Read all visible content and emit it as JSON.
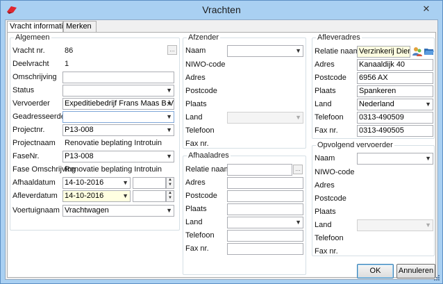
{
  "window": {
    "title": "Vrachten",
    "close_glyph": "✕"
  },
  "tabs": [
    {
      "label": "Vracht informatie"
    },
    {
      "label": "Merken"
    }
  ],
  "algemeen": {
    "title": "Algemeen",
    "vracht_nr": {
      "label": "Vracht nr.",
      "value": "86"
    },
    "deelvracht": {
      "label": "Deelvracht",
      "value": "1"
    },
    "omschrijving": {
      "label": "Omschrijving",
      "value": ""
    },
    "status": {
      "label": "Status",
      "value": ""
    },
    "vervoerder": {
      "label": "Vervoerder",
      "value": "Expeditiebedrijf Frans Maas B.V."
    },
    "geadresseerde": {
      "label": "Geadresseerde",
      "value": ""
    },
    "projectnr": {
      "label": "Projectnr.",
      "value": "P13-008"
    },
    "projectnaam": {
      "label": "Projectnaam",
      "value": "Renovatie beplating Introtuin"
    },
    "fasenr": {
      "label": "FaseNr.",
      "value": "P13-008"
    },
    "fase_omschrijving": {
      "label": "Fase Omschrijving",
      "value": "Renovatie beplating Introtuin"
    },
    "afhaaldatum": {
      "label": "Afhaaldatum",
      "value": "14-10-2016",
      "time": ""
    },
    "afleverdatum": {
      "label": "Afleverdatum",
      "value": "14-10-2016",
      "time": ""
    },
    "voertuignaam": {
      "label": "Voertuignaam",
      "value": "Vrachtwagen"
    }
  },
  "afzender": {
    "title": "Afzender",
    "naam": {
      "label": "Naam",
      "value": ""
    },
    "niwo": {
      "label": "NIWO-code"
    },
    "adres": {
      "label": "Adres"
    },
    "postcode": {
      "label": "Postcode"
    },
    "plaats": {
      "label": "Plaats"
    },
    "land": {
      "label": "Land",
      "value": ""
    },
    "telefoon": {
      "label": "Telefoon"
    },
    "fax": {
      "label": "Fax nr."
    }
  },
  "afhaaladres": {
    "title": "Afhaaladres",
    "relatie": {
      "label": "Relatie naam",
      "value": ""
    },
    "adres": {
      "label": "Adres",
      "value": ""
    },
    "postcode": {
      "label": "Postcode",
      "value": ""
    },
    "plaats": {
      "label": "Plaats",
      "value": ""
    },
    "land": {
      "label": "Land",
      "value": ""
    },
    "telefoon": {
      "label": "Telefoon",
      "value": ""
    },
    "fax": {
      "label": "Fax nr.",
      "value": ""
    }
  },
  "afleveradres": {
    "title": "Afleveradres",
    "relatie": {
      "label": "Relatie naam",
      "value": "Verzinkerij Dieren B"
    },
    "adres": {
      "label": "Adres",
      "value": "Kanaaldijk 40"
    },
    "postcode": {
      "label": "Postcode",
      "value": "6956 AX"
    },
    "plaats": {
      "label": "Plaats",
      "value": "Spankeren"
    },
    "land": {
      "label": "Land",
      "value": "Nederland"
    },
    "telefoon": {
      "label": "Telefoon",
      "value": "0313-490509"
    },
    "fax": {
      "label": "Fax nr.",
      "value": "0313-490505"
    }
  },
  "opvolgend": {
    "title": "Opvolgend vervoerder",
    "naam": {
      "label": "Naam",
      "value": ""
    },
    "niwo": {
      "label": "NIWO-code"
    },
    "adres": {
      "label": "Adres"
    },
    "postcode": {
      "label": "Postcode"
    },
    "plaats": {
      "label": "Plaats"
    },
    "land": {
      "label": "Land",
      "value": ""
    },
    "telefoon": {
      "label": "Telefoon"
    },
    "fax": {
      "label": "Fax nr."
    }
  },
  "buttons": {
    "ok": "OK",
    "cancel": "Annuleren"
  },
  "glyphs": {
    "ellipsis": "...",
    "dropdown": "▼",
    "spin_up": "▲",
    "spin_down": "▼"
  },
  "colors": {
    "title_bar": "#a9d0f2",
    "accent": "#3c7fb1",
    "app_icon": "#e0262f",
    "date_highlight": "#ffffe1"
  }
}
